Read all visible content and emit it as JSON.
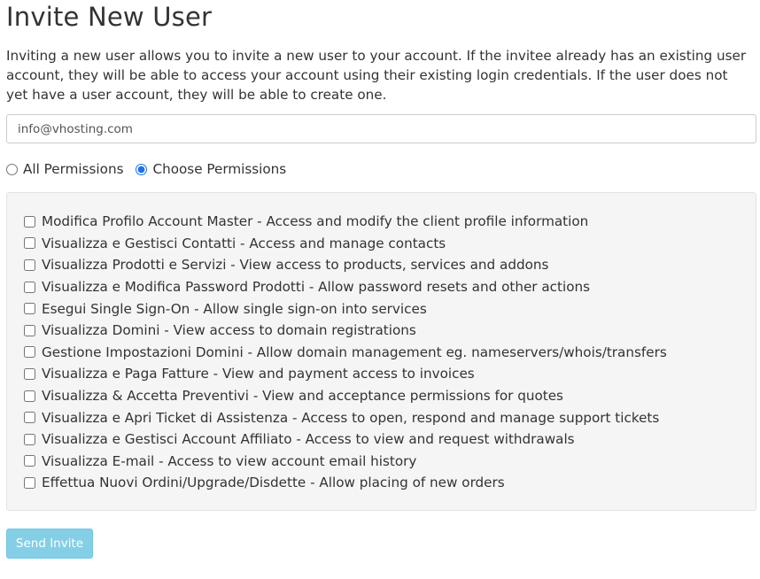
{
  "page": {
    "title": "Invite New User",
    "intro": "Inviting a new user allows you to invite a new user to your account. If the invitee already has an existing user account, they will be able to access your account using their existing login credentials. If the user does not yet have a user account, they will be able to create one."
  },
  "form": {
    "email_value": "info@vhosting.com",
    "permission_mode": {
      "all_label": "All Permissions",
      "choose_label": "Choose Permissions",
      "selected": "choose"
    },
    "permissions": [
      {
        "label": "Modifica Profilo Account Master - Access and modify the client profile information",
        "checked": false
      },
      {
        "label": "Visualizza e Gestisci Contatti - Access and manage contacts",
        "checked": false
      },
      {
        "label": "Visualizza Prodotti e Servizi - View access to products, services and addons",
        "checked": false
      },
      {
        "label": "Visualizza e Modifica Password Prodotti - Allow password resets and other actions",
        "checked": false
      },
      {
        "label": "Esegui Single Sign-On - Allow single sign-on into services",
        "checked": false
      },
      {
        "label": "Visualizza Domini - View access to domain registrations",
        "checked": false
      },
      {
        "label": "Gestione Impostazioni Domini - Allow domain management eg. nameservers/whois/transfers",
        "checked": false
      },
      {
        "label": "Visualizza e Paga Fatture - View and payment access to invoices",
        "checked": false
      },
      {
        "label": "Visualizza & Accetta Preventivi - View and acceptance permissions for quotes",
        "checked": false
      },
      {
        "label": "Visualizza e Apri Ticket di Assistenza - Access to open, respond and manage support tickets",
        "checked": false
      },
      {
        "label": "Visualizza e Gestisci Account Affiliato - Access to view and request withdrawals",
        "checked": false
      },
      {
        "label": "Visualizza E-mail - Access to view account email history",
        "checked": false
      },
      {
        "label": "Effettua Nuovi Ordini/Upgrade/Disdette - Allow placing of new orders",
        "checked": false
      }
    ],
    "submit_label": "Send Invite"
  },
  "colors": {
    "button_bg": "#5bc0de",
    "well_bg": "#f5f5f5",
    "text": "#333333"
  }
}
